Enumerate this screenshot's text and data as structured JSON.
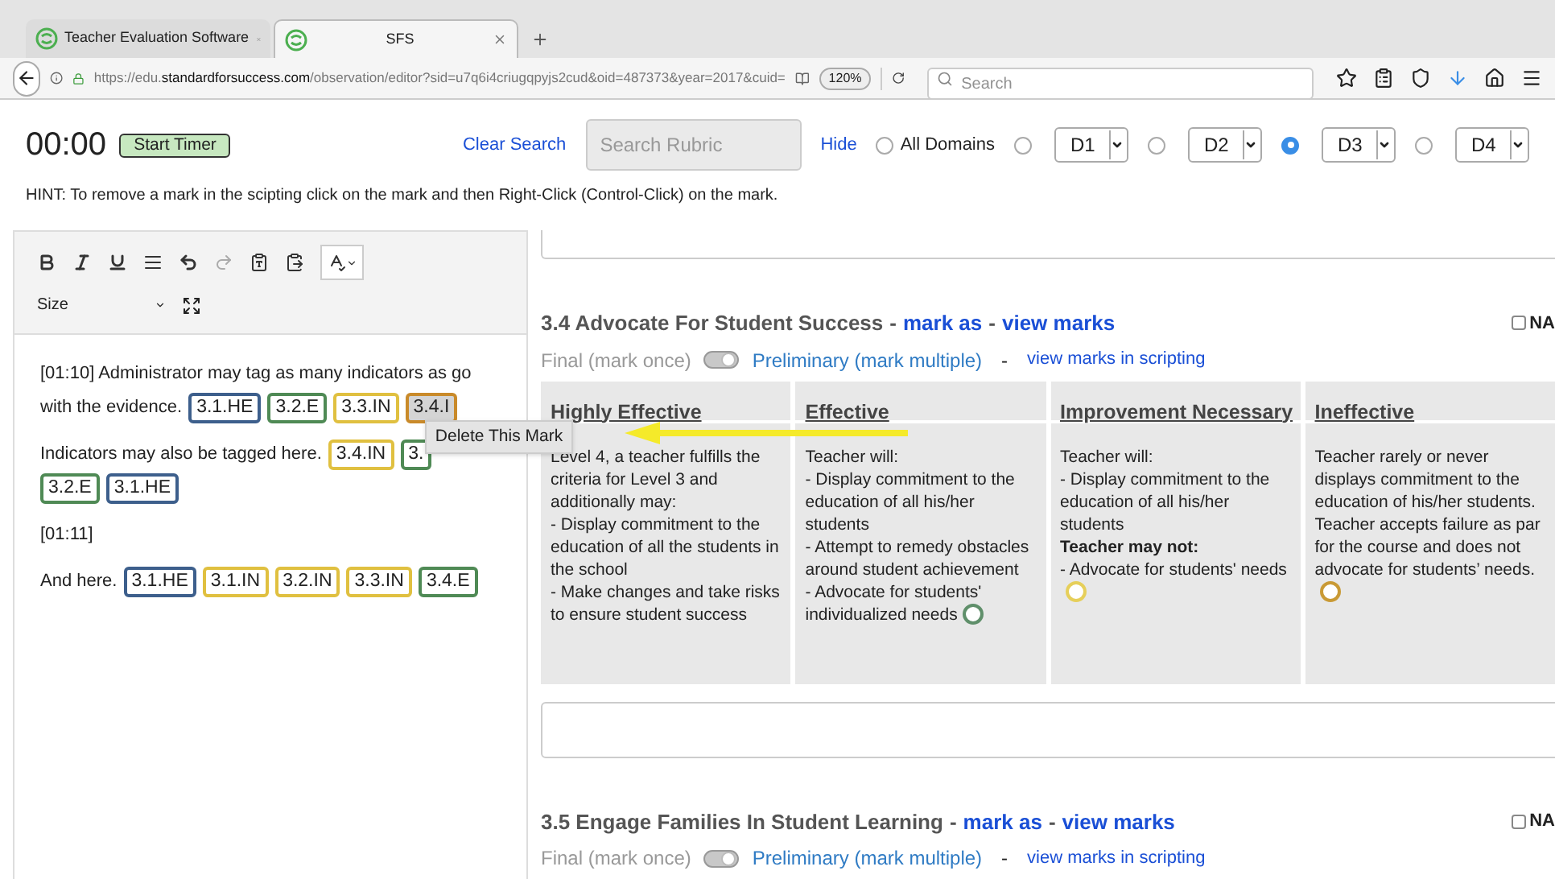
{
  "browser": {
    "tabs": [
      {
        "title": "Teacher Evaluation Software",
        "selected": false
      },
      {
        "title": "SFS",
        "selected": true
      }
    ],
    "url_prefix": "https://edu.",
    "url_host": "standardforsuccess.com",
    "url_path": "/observation/editor?sid=u7q6i4criugqpyjs2cud&oid=487373&year=2017&cuid=",
    "zoom": "120%",
    "search": {
      "placeholder": "Search"
    }
  },
  "header": {
    "timer": "00:00",
    "start_button": "Start Timer",
    "clear_search": "Clear Search",
    "search": {
      "placeholder": "Search Rubric"
    },
    "hide": "Hide",
    "domains": [
      {
        "label": "All Domains",
        "selected": false,
        "kind": "radio"
      },
      {
        "label": "D1",
        "selected": false,
        "kind": "dropdown"
      },
      {
        "label": "D2",
        "selected": false,
        "kind": "dropdown"
      },
      {
        "label": "D3",
        "selected": true,
        "kind": "dropdown"
      },
      {
        "label": "D4",
        "selected": false,
        "kind": "dropdown"
      }
    ]
  },
  "hint": "HINT: To remove a mark in the scipting click on the mark and then Right-Click (Control-Click) on the mark.",
  "editor": {
    "size_label": "Size",
    "paragraphs": [
      {
        "lines": [
          "[01:10] Administrator may tag as many indicators as go",
          "with the evidence."
        ],
        "tags": [
          {
            "label": "3.1.HE",
            "color": "#3d5f8c",
            "selected": false
          },
          {
            "label": "3.2.E",
            "color": "#4f8a55",
            "selected": false
          },
          {
            "label": "3.3.IN",
            "color": "#e0c040",
            "selected": false
          },
          {
            "label": "3.4.I",
            "color": "#c98a2a",
            "selected": true
          }
        ]
      },
      {
        "lines": [
          "Indicators may also be tagged here."
        ],
        "tags": [
          {
            "label": "3.4.IN",
            "color": "#e0c040",
            "selected": false
          },
          {
            "label": "3.",
            "color": "#4f8a55",
            "selected": false
          },
          {
            "label": "3.2.E",
            "color": "#4f8a55",
            "selected": false
          },
          {
            "label": "3.1.HE",
            "color": "#3d5f8c",
            "selected": false
          }
        ]
      },
      {
        "lines": [
          "[01:11]"
        ]
      },
      {
        "lines": [
          "And here."
        ],
        "tags": [
          {
            "label": "3.1.HE",
            "color": "#3d5f8c",
            "selected": false
          },
          {
            "label": "3.1.IN",
            "color": "#e0c040",
            "selected": false
          },
          {
            "label": "3.2.IN",
            "color": "#e0c040",
            "selected": false
          },
          {
            "label": "3.3.IN",
            "color": "#e0c040",
            "selected": false
          },
          {
            "label": "3.4.E",
            "color": "#4f8a55",
            "selected": false
          }
        ]
      }
    ]
  },
  "context_menu": {
    "item": "Delete This Mark"
  },
  "sections": [
    {
      "title": "3.4 Advocate For Student Success",
      "mark_as": "mark as",
      "view_marks": "view marks",
      "na": "NA",
      "na_checked": false,
      "final": "Final (mark once)",
      "preliminary": "Preliminary (mark multiple)",
      "toggle_on": true,
      "separator": "-",
      "view_in_scripting": "view marks in scripting",
      "levels": [
        {
          "heading": "Highly Effective",
          "lines": [
            {
              "text": "Level 4, a teacher fulfills the criteria for Level 3 and additionally may:",
              "bold": false
            },
            {
              "text": "- Display commitment to the education of all the students in the school",
              "bold": false
            },
            {
              "text": "- Make changes and take risks to ensure student success",
              "bold": false
            }
          ]
        },
        {
          "heading": "Effective",
          "lines": [
            {
              "text": "Teacher will:",
              "bold": false
            },
            {
              "text": "- Display commitment to the education of all his/her students",
              "bold": false
            },
            {
              "text": "- Attempt to remedy obstacles around student achievement",
              "bold": false
            },
            {
              "text": "- Advocate for students' individualized needs",
              "bold": false
            }
          ],
          "color": "#5f8f6a"
        },
        {
          "heading": "Improvement Necessary",
          "lines": [
            {
              "text": "Teacher will:",
              "bold": false
            },
            {
              "text": "- Display commitment to the education of all his/her students",
              "bold": false
            },
            {
              "text": "Teacher may not:",
              "bold": true
            },
            {
              "text": "- Advocate for students' needs",
              "bold": false
            }
          ],
          "color": "#e6cf5a"
        },
        {
          "heading": "Ineffective",
          "lines": [
            {
              "text": "Teacher rarely or never displays commitment to the education of his/her students. Teacher accepts failure as par for the course and does not advocate for students’ needs.",
              "bold": false
            }
          ],
          "color": "#c99a35"
        }
      ]
    },
    {
      "title": "3.5 Engage Families In Student Learning",
      "mark_as": "mark as",
      "view_marks": "view marks",
      "na": "NA",
      "na_checked": false,
      "final": "Final (mark once)",
      "preliminary": "Preliminary (mark multiple)",
      "toggle_on": true,
      "separator": "-",
      "view_in_scripting": "view marks in scripting"
    }
  ]
}
